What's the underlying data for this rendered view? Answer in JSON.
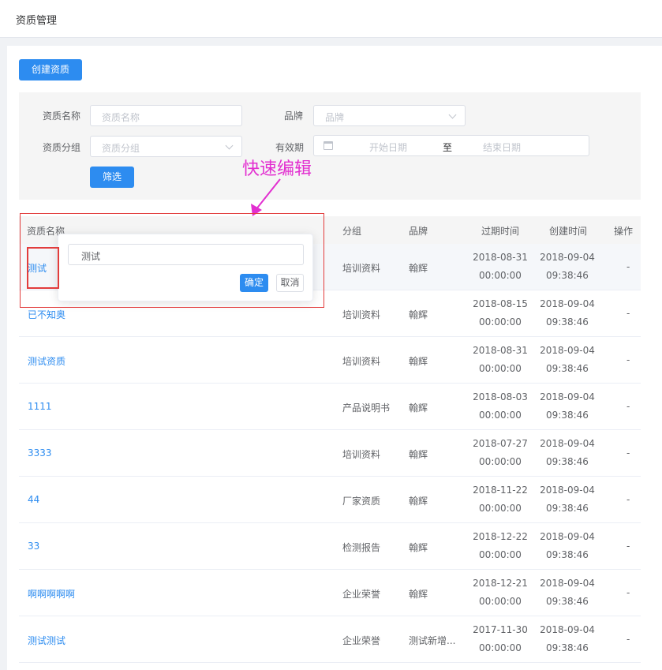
{
  "header": {
    "title": "资质管理"
  },
  "toolbar": {
    "create_label": "创建资质"
  },
  "filters": {
    "name_label": "资质名称",
    "name_placeholder": "资质名称",
    "brand_label": "品牌",
    "brand_placeholder": "品牌",
    "group_label": "资质分组",
    "group_placeholder": "资质分组",
    "validity_label": "有效期",
    "start_placeholder": "开始日期",
    "range_sep": "至",
    "end_placeholder": "结束日期",
    "filter_button": "筛选"
  },
  "annotation": {
    "text": "快速编辑",
    "color": "#e22ed0"
  },
  "table": {
    "columns": [
      "资质名称",
      "分组",
      "品牌",
      "过期时间",
      "创建时间",
      "操作"
    ],
    "rows": [
      {
        "name": "测试",
        "group": "培训资料",
        "brand": "翰辉",
        "expire_date": "2018-08-31",
        "expire_time": "00:00:00",
        "create_date": "2018-09-04",
        "create_time": "09:38:46",
        "op": "-"
      },
      {
        "name": "已不知奥",
        "group": "培训资料",
        "brand": "翰辉",
        "expire_date": "2018-08-15",
        "expire_time": "00:00:00",
        "create_date": "2018-09-04",
        "create_time": "09:38:46",
        "op": "-"
      },
      {
        "name": "测试资质",
        "group": "培训资料",
        "brand": "翰辉",
        "expire_date": "2018-08-31",
        "expire_time": "00:00:00",
        "create_date": "2018-09-04",
        "create_time": "09:38:46",
        "op": "-"
      },
      {
        "name": "1111",
        "group": "产品说明书",
        "brand": "翰辉",
        "expire_date": "2018-08-03",
        "expire_time": "00:00:00",
        "create_date": "2018-09-04",
        "create_time": "09:38:46",
        "op": "-"
      },
      {
        "name": "3333",
        "group": "培训资料",
        "brand": "翰辉",
        "expire_date": "2018-07-27",
        "expire_time": "00:00:00",
        "create_date": "2018-09-04",
        "create_time": "09:38:46",
        "op": "-"
      },
      {
        "name": "44",
        "group": "厂家资质",
        "brand": "翰辉",
        "expire_date": "2018-11-22",
        "expire_time": "00:00:00",
        "create_date": "2018-09-04",
        "create_time": "09:38:46",
        "op": "-"
      },
      {
        "name": "33",
        "group": "检测报告",
        "brand": "翰辉",
        "expire_date": "2018-12-22",
        "expire_time": "00:00:00",
        "create_date": "2018-09-04",
        "create_time": "09:38:46",
        "op": "-"
      },
      {
        "name": "啊啊啊啊啊",
        "group": "企业荣誉",
        "brand": "翰辉",
        "expire_date": "2018-12-21",
        "expire_time": "00:00:00",
        "create_date": "2018-09-04",
        "create_time": "09:38:46",
        "op": "-"
      },
      {
        "name": "测试测试",
        "group": "企业荣誉",
        "brand": "测试新增...",
        "expire_date": "2017-11-30",
        "expire_time": "00:00:00",
        "create_date": "2018-09-04",
        "create_time": "09:38:46",
        "op": "-"
      }
    ]
  },
  "popover": {
    "input_value": "测试",
    "ok_label": "确定",
    "cancel_label": "取消"
  },
  "colors": {
    "primary": "#2d8cf0",
    "highlight_box": "#e23c3c"
  }
}
